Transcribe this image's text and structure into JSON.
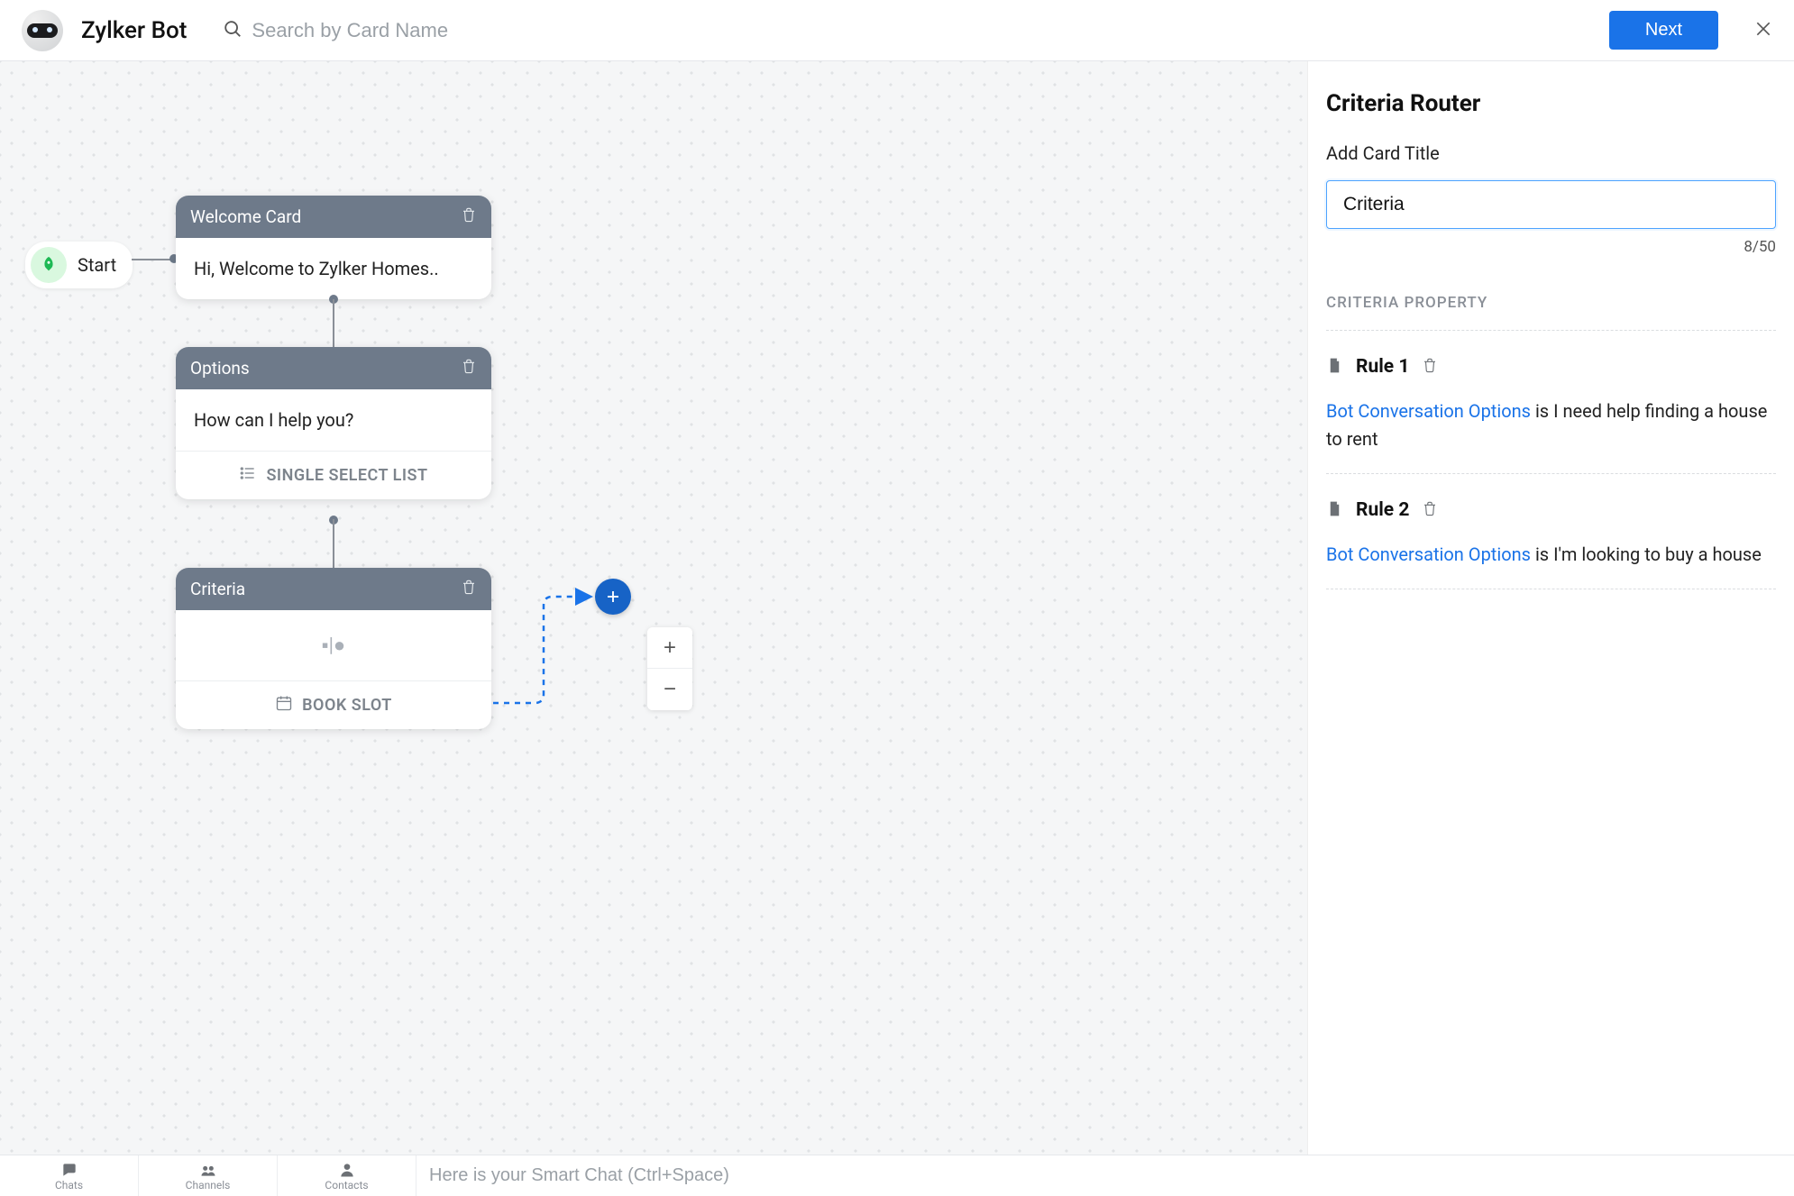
{
  "header": {
    "bot_name": "Zylker Bot",
    "search_placeholder": "Search by Card Name",
    "next_label": "Next"
  },
  "canvas": {
    "start_label": "Start",
    "cards": {
      "welcome": {
        "title": "Welcome Card",
        "body": "Hi, Welcome to Zylker Homes.."
      },
      "options": {
        "title": "Options",
        "body": "How can I help you?",
        "footer": "SINGLE SELECT LIST"
      },
      "criteria": {
        "title": "Criteria",
        "body_glyph": "▪|●",
        "footer": "BOOK SLOT"
      }
    }
  },
  "panel": {
    "title": "Criteria Router",
    "add_title_label": "Add Card Title",
    "title_value": "Criteria",
    "counter": "8/50",
    "section_label": "CRITERIA PROPERTY",
    "rules": [
      {
        "name": "Rule 1",
        "link_text": "Bot Conversation Options",
        "cond_text": " is I need help finding a house to rent"
      },
      {
        "name": "Rule 2",
        "link_text": "Bot Conversation Options",
        "cond_text": " is I'm looking to buy a house"
      }
    ]
  },
  "bottom": {
    "tabs": [
      "Chats",
      "Channels",
      "Contacts"
    ],
    "smart_placeholder": "Here is your Smart Chat (Ctrl+Space)"
  }
}
